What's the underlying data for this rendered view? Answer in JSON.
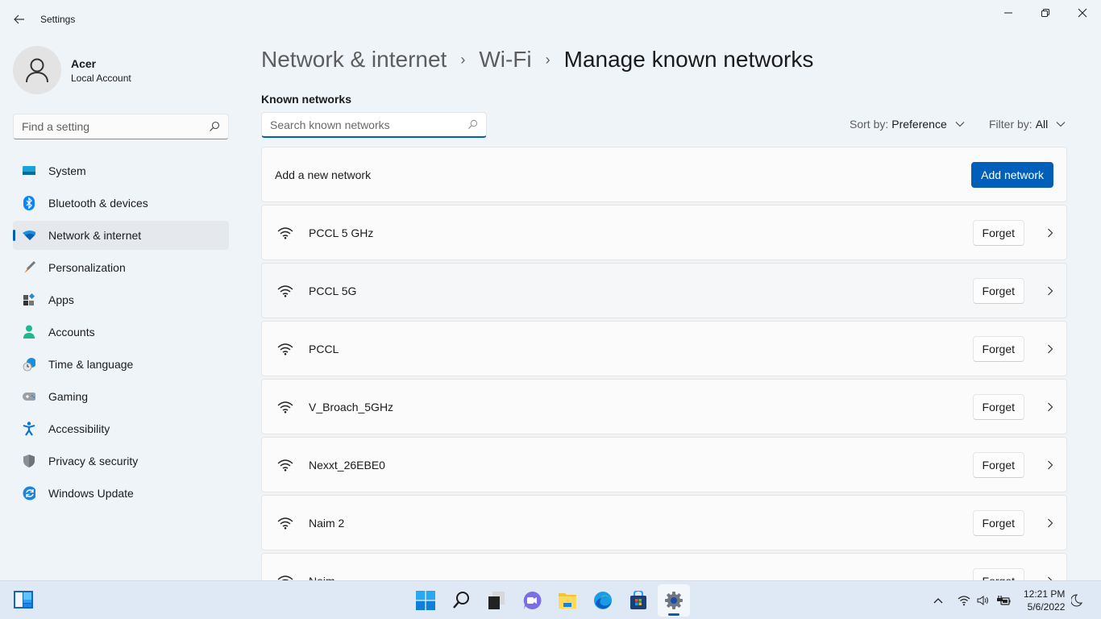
{
  "window": {
    "title": "Settings",
    "controls": {
      "minimize": "minimize",
      "maximize": "restore",
      "close": "close"
    }
  },
  "profile": {
    "name": "Acer",
    "account_type": "Local Account"
  },
  "sidebar": {
    "search_placeholder": "Find a setting",
    "items": [
      {
        "label": "System",
        "icon": "system-icon",
        "active": false
      },
      {
        "label": "Bluetooth & devices",
        "icon": "bluetooth-icon",
        "active": false
      },
      {
        "label": "Network & internet",
        "icon": "wifi-icon",
        "active": true
      },
      {
        "label": "Personalization",
        "icon": "brush-icon",
        "active": false
      },
      {
        "label": "Apps",
        "icon": "apps-icon",
        "active": false
      },
      {
        "label": "Accounts",
        "icon": "person-icon",
        "active": false
      },
      {
        "label": "Time & language",
        "icon": "clock-globe-icon",
        "active": false
      },
      {
        "label": "Gaming",
        "icon": "gamepad-icon",
        "active": false
      },
      {
        "label": "Accessibility",
        "icon": "accessibility-icon",
        "active": false
      },
      {
        "label": "Privacy & security",
        "icon": "shield-icon",
        "active": false
      },
      {
        "label": "Windows Update",
        "icon": "update-icon",
        "active": false
      }
    ]
  },
  "breadcrumb": {
    "items": [
      "Network & internet",
      "Wi-Fi",
      "Manage known networks"
    ],
    "separator": "›"
  },
  "known_networks": {
    "section_label": "Known networks",
    "search_placeholder": "Search known networks",
    "search_value": "",
    "sort": {
      "label": "Sort by:",
      "value": "Preference"
    },
    "filter": {
      "label": "Filter by:",
      "value": "All"
    },
    "add": {
      "text": "Add a new network",
      "button": "Add network"
    },
    "forget_label": "Forget",
    "networks": [
      {
        "name": "PCCL 5 GHz"
      },
      {
        "name": "PCCL 5G"
      },
      {
        "name": "PCCL"
      },
      {
        "name": "V_Broach_5GHz"
      },
      {
        "name": "Nexxt_26EBE0"
      },
      {
        "name": "Naim 2"
      },
      {
        "name": "Naim"
      }
    ]
  },
  "taskbar": {
    "apps": [
      "start",
      "search",
      "task-view",
      "teams-chat",
      "file-explorer",
      "edge",
      "store",
      "settings"
    ],
    "active_app": "settings",
    "time": "12:21 PM",
    "date": "5/6/2022"
  },
  "colors": {
    "accent": "#005fb8",
    "background": "#eff4f9",
    "card": "#fbfbfc"
  }
}
